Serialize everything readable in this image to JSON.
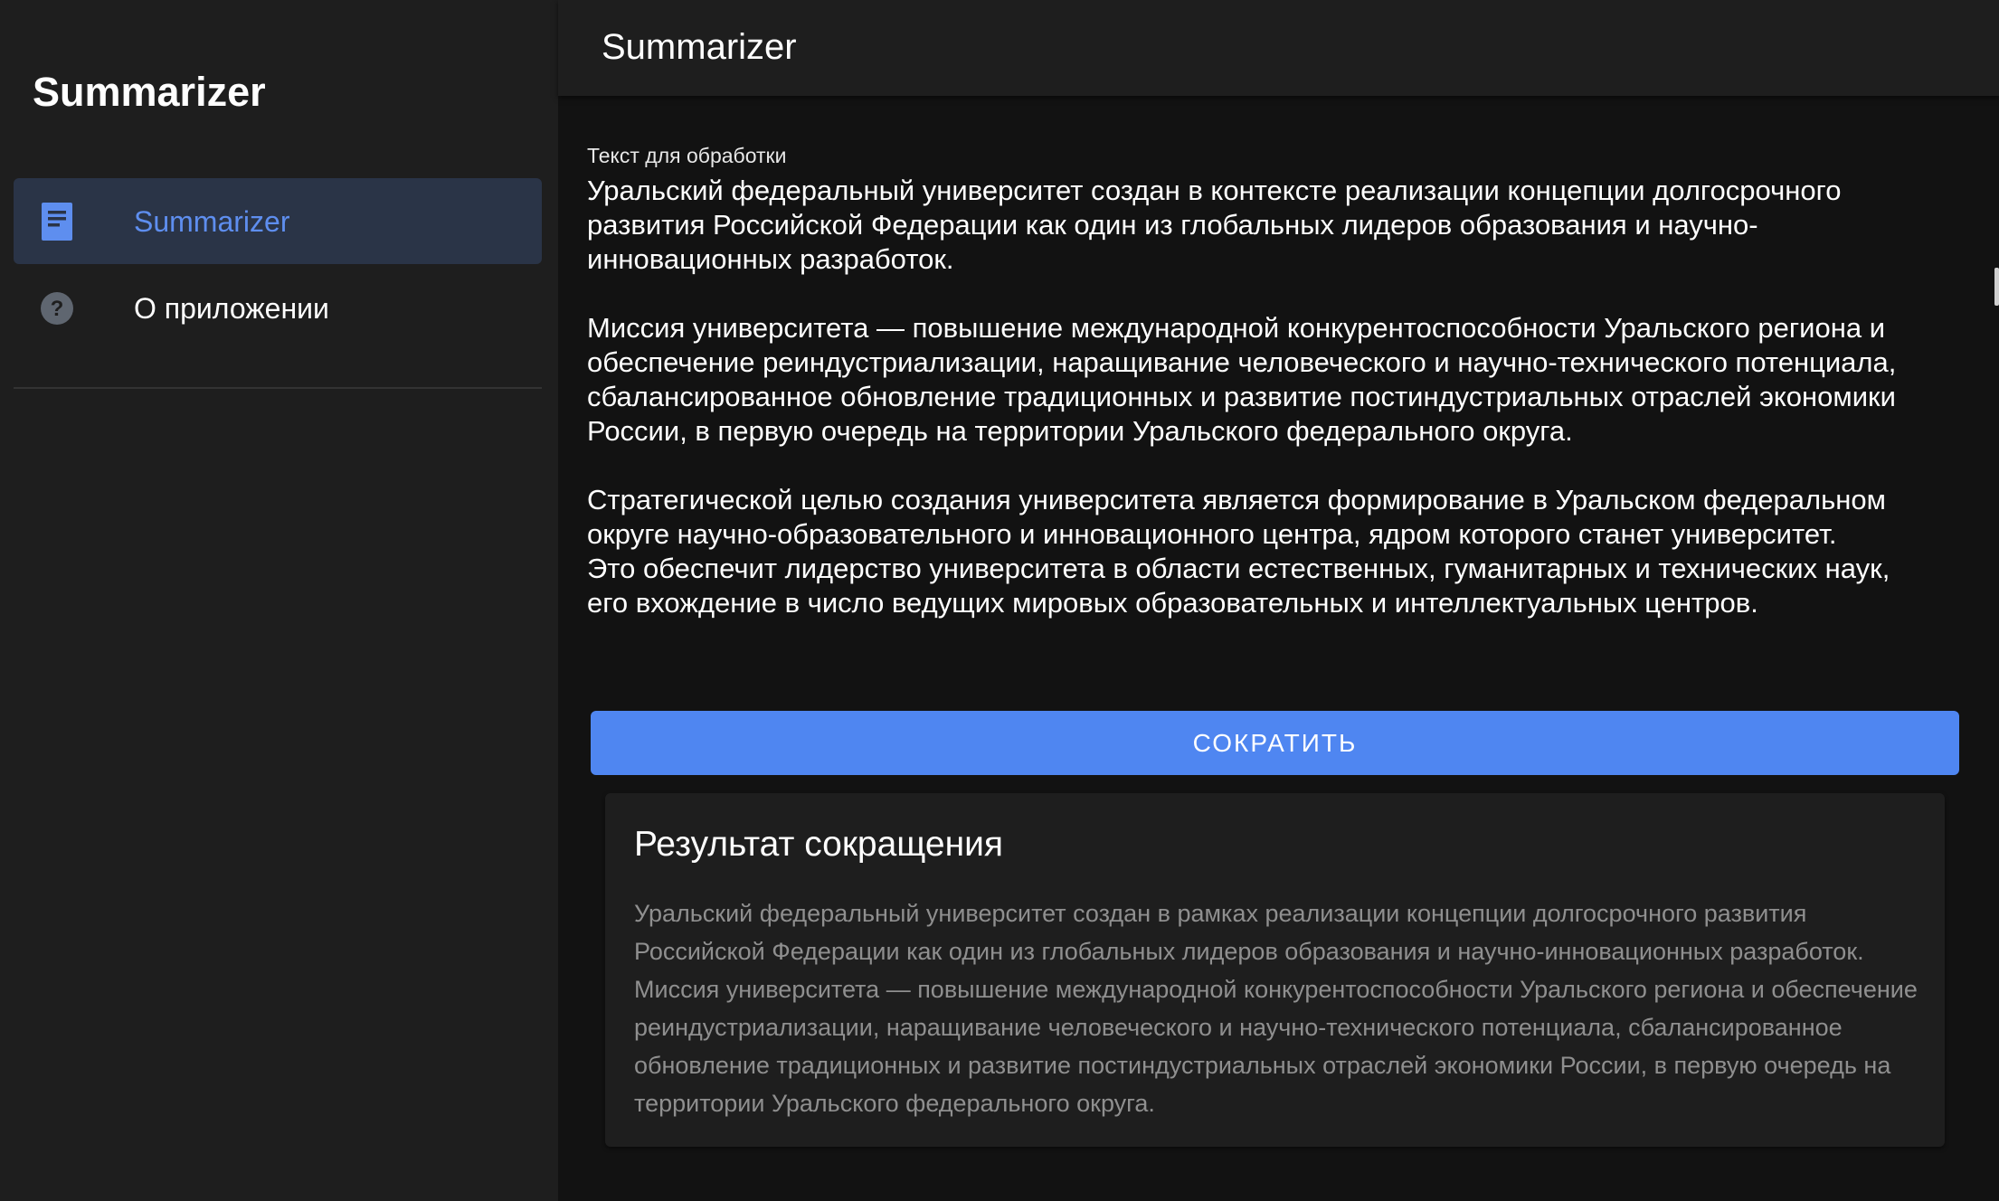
{
  "sidebar": {
    "title": "Summarizer",
    "items": [
      {
        "label": "Summarizer",
        "icon": "document-icon",
        "active": true
      },
      {
        "label": "О приложении",
        "icon": "help-circle-icon",
        "active": false
      }
    ]
  },
  "header": {
    "title": "Summarizer"
  },
  "input": {
    "label": "Текст для обработки",
    "value": "Уральский федеральный университет создан в контексте реализации концепции долгосрочного\nразвития Российской Федерации как один из глобальных лидеров образования и научно-\nинновационных разработок.\n\nМиссия университета — повышение международной конкурентоспособности Уральского региона и\nобеспечение реиндустриализации, наращивание человеческого и научно-технического потенциала,\nсбалансированное обновление традиционных и развитие постиндустриальных отраслей экономики\nРоссии, в первую очередь на территории Уральского федерального округа.\n\nСтратегической целью создания университета является формирование в Уральском федеральном\nокруге научно-образовательного и инновационного центра, ядром которого станет университет.\nЭто обеспечит лидерство университета в области естественных, гуманитарных и технических наук,\nего вхождение в число ведущих мировых образовательных и интеллектуальных центров."
  },
  "action": {
    "submit_label": "СОКРАТИТЬ"
  },
  "result": {
    "title": "Результат сокращения",
    "text": "Уральский федеральный университет создан в рамках реализации концепции долгосрочного развития Российской Федерации как один из глобальных лидеров образования и научно-инновационных разработок. Миссия университета — повышение международной конкурентоспособности Уральского региона и обеспечение реиндустриализации, наращивание человеческого и научно-технического потенциала, сбалансированное обновление традиционных и развитие постиндустриальных отраслей экономики России, в первую очередь на территории Уральского федерального округа."
  },
  "colors": {
    "accent": "#4f86f1",
    "active_nav_text": "#5e8eef",
    "active_nav_bg": "#2a3447",
    "sidebar_bg": "#1e1e1e",
    "main_bg": "#121212"
  }
}
